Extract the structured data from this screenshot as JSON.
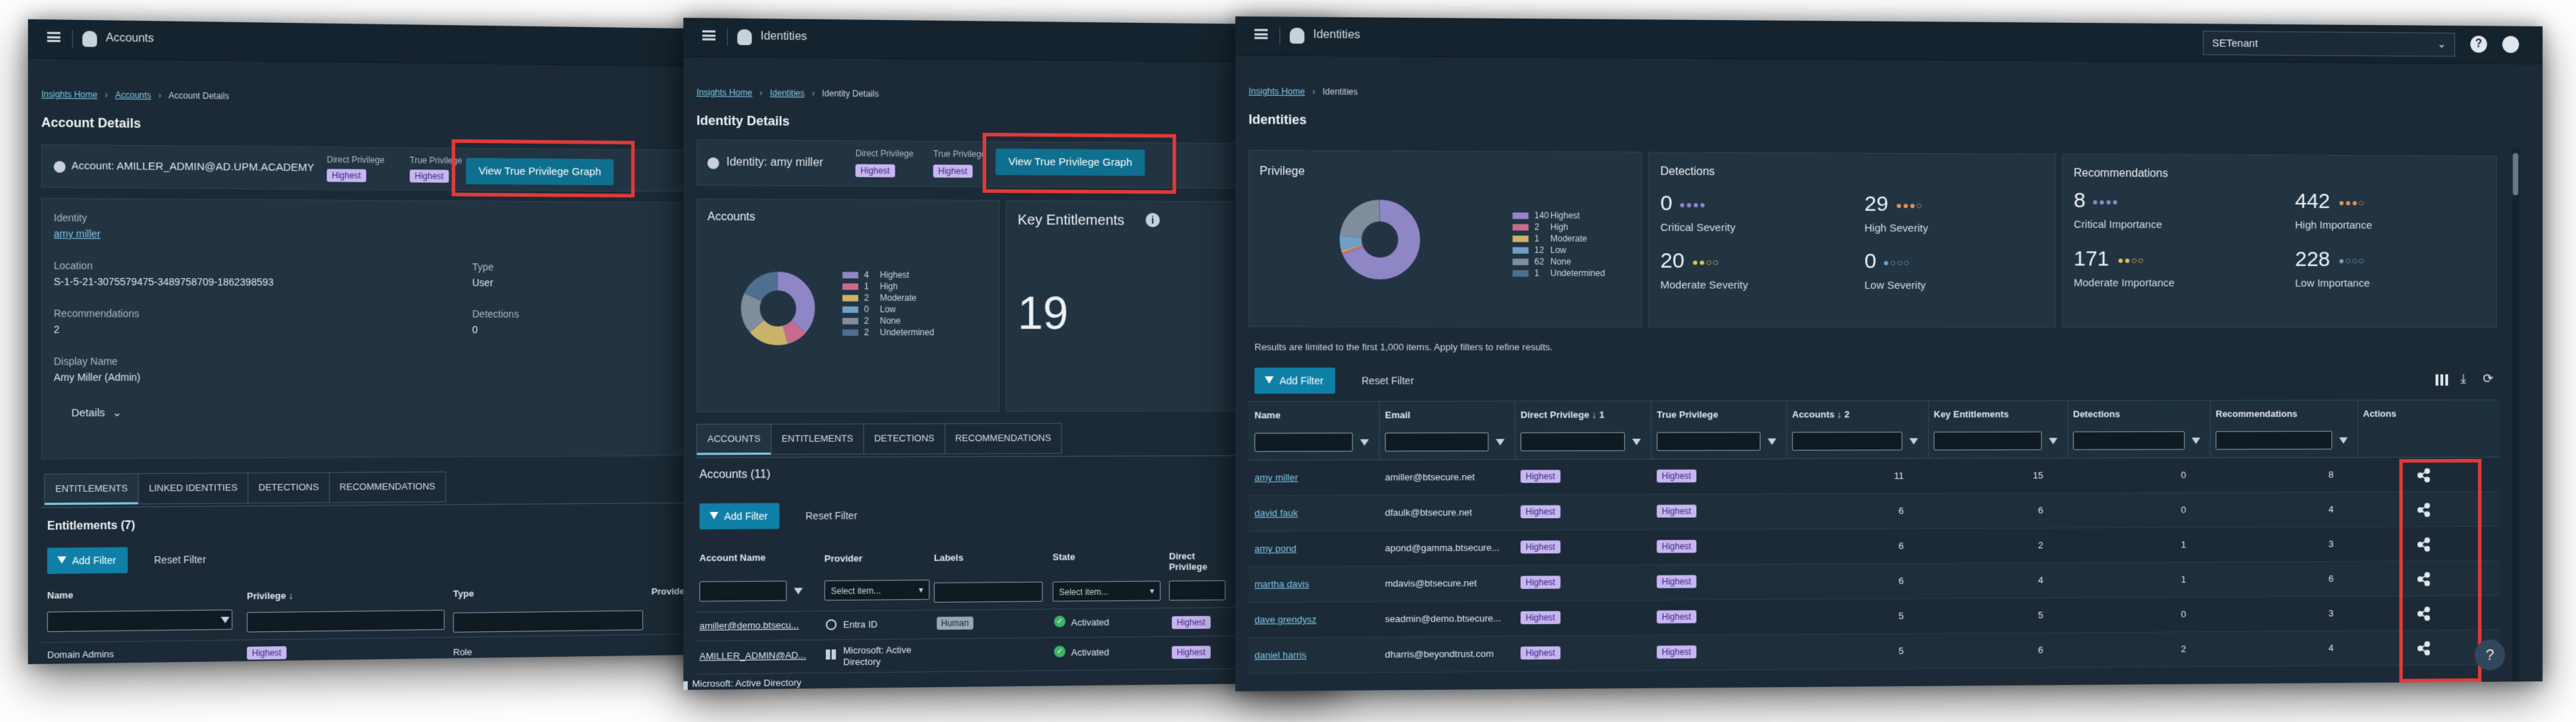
{
  "w1": {
    "topbar_title": "Accounts",
    "crumbs": [
      "Insights Home",
      "Accounts",
      "Account Details"
    ],
    "page_title": "Account Details",
    "account_label": "Account: AMILLER_ADMIN@AD.UPM.ACADEMY",
    "direct_priv_label": "Direct Privilege",
    "direct_priv_value": "Highest",
    "true_priv_label": "True Privilege",
    "true_priv_value": "Highest",
    "vtpg_button": "View True Privilege Graph",
    "identity_label": "Identity",
    "identity_value": "amy miller",
    "location_label": "Location",
    "location_value": "S-1-5-21-3075579475-3489758709-1862398593",
    "type_label": "Type",
    "type_value": "User",
    "recs_label": "Recommendations",
    "recs_value": "2",
    "detections_label": "Detections",
    "detections_value": "0",
    "display_name_label": "Display Name",
    "display_name_value": "Amy Miller (Admin)",
    "details_toggle": "Details",
    "tabs": [
      "ENTITLEMENTS",
      "LINKED IDENTITIES",
      "DETECTIONS",
      "RECOMMENDATIONS"
    ],
    "section_title": "Entitlements (7)",
    "add_filter": "Add Filter",
    "reset_filter": "Reset Filter",
    "columns": [
      "Name",
      "Privilege",
      "Type",
      "Provider"
    ],
    "row": {
      "name": "Domain Admins",
      "privilege": "Highest",
      "type": "Role"
    }
  },
  "w2": {
    "topbar_title": "Identities",
    "crumbs": [
      "Insights Home",
      "Identities",
      "Identity Details"
    ],
    "page_title": "Identity Details",
    "identity_label": "Identity: amy miller",
    "direct_priv_label": "Direct Privilege",
    "direct_priv_value": "Highest",
    "true_priv_label": "True Privilege",
    "true_priv_value": "Highest",
    "vtpg_button": "View True Privilege Graph",
    "accounts_title": "Accounts",
    "legend": [
      {
        "n": "4",
        "label": "Highest",
        "color": "#8f86c6"
      },
      {
        "n": "1",
        "label": "High",
        "color": "#c86b8e"
      },
      {
        "n": "2",
        "label": "Moderate",
        "color": "#c9b36a"
      },
      {
        "n": "0",
        "label": "Low",
        "color": "#6fa0c8"
      },
      {
        "n": "2",
        "label": "None",
        "color": "#7f8e9c"
      },
      {
        "n": "2",
        "label": "Undetermined",
        "color": "#4f6f90"
      }
    ],
    "key_ent_title": "Key Entitlements",
    "key_ent_value": "19",
    "tabs": [
      "ACCOUNTS",
      "ENTITLEMENTS",
      "DETECTIONS",
      "RECOMMENDATIONS"
    ],
    "section_title": "Accounts (11)",
    "add_filter": "Add Filter",
    "reset_filter": "Reset Filter",
    "columns": [
      "Account Name",
      "Provider",
      "Labels",
      "State",
      "Direct Privilege"
    ],
    "select_placeholder": "Select item...",
    "rows": [
      {
        "name": "amiller@demo.btsecu...",
        "provider": "Entra ID",
        "label": "Human",
        "state": "Activated",
        "priv": "Highest"
      },
      {
        "name": "AMILLER_ADMIN@AD...",
        "provider": "Microsoft: Active Directory",
        "label": "",
        "state": "Activated",
        "priv": "Highest"
      }
    ],
    "footer_provider": "Microsoft: Active Directory"
  },
  "w3": {
    "topbar_title": "Identities",
    "tenant": "SETenant",
    "crumbs": [
      "Insights Home",
      "Identities"
    ],
    "page_title": "Identities",
    "privilege_title": "Privilege",
    "legend": [
      {
        "n": "140",
        "label": "Highest",
        "color": "#8f86c6"
      },
      {
        "n": "2",
        "label": "High",
        "color": "#c86b8e"
      },
      {
        "n": "1",
        "label": "Moderate",
        "color": "#c9b36a"
      },
      {
        "n": "12",
        "label": "Low",
        "color": "#6fa0c8"
      },
      {
        "n": "62",
        "label": "None",
        "color": "#7f8e9c"
      },
      {
        "n": "1",
        "label": "Undetermined",
        "color": "#4f6f90"
      }
    ],
    "detections_title": "Detections",
    "detections": [
      {
        "n": "0",
        "label": "Critical Severity",
        "dots": "●●●●"
      },
      {
        "n": "29",
        "label": "High Severity",
        "dots": "●●●○"
      },
      {
        "n": "20",
        "label": "Moderate Severity",
        "dots": "●●○○"
      },
      {
        "n": "0",
        "label": "Low Severity",
        "dots": "●○○○"
      }
    ],
    "recs_title": "Recommendations",
    "recs": [
      {
        "n": "8",
        "label": "Critical Importance",
        "dots": "●●●●"
      },
      {
        "n": "442",
        "label": "High Importance",
        "dots": "●●●○"
      },
      {
        "n": "171",
        "label": "Moderate Importance",
        "dots": "●●○○"
      },
      {
        "n": "228",
        "label": "Low Importance",
        "dots": "●○○○"
      }
    ],
    "limit_note": "Results are limited to the first 1,000 items. Apply filters to refine results.",
    "add_filter": "Add Filter",
    "reset_filter": "Reset Filter",
    "columns": [
      "Name",
      "Email",
      "Direct Privilege ↓ 1",
      "True Privilege",
      "Accounts ↓ 2",
      "Key Entitlements",
      "Detections",
      "Recommendations",
      "Actions"
    ],
    "rows": [
      {
        "name": "amy miller",
        "email": "amiller@btsecure.net",
        "dp": "Highest",
        "tp": "Highest",
        "acc": "11",
        "ke": "15",
        "det": "0",
        "rec": "8"
      },
      {
        "name": "david fauk",
        "email": "dfaulk@btsecure.net",
        "dp": "Highest",
        "tp": "Highest",
        "acc": "6",
        "ke": "6",
        "det": "0",
        "rec": "4"
      },
      {
        "name": "amy pond",
        "email": "apond@gamma.btsecure...",
        "dp": "Highest",
        "tp": "Highest",
        "acc": "6",
        "ke": "2",
        "det": "1",
        "rec": "3"
      },
      {
        "name": "martha davis",
        "email": "mdavis@btsecure.net",
        "dp": "Highest",
        "tp": "Highest",
        "acc": "6",
        "ke": "4",
        "det": "1",
        "rec": "6"
      },
      {
        "name": "dave grendysz",
        "email": "seadmin@demo.btsecure...",
        "dp": "Highest",
        "tp": "Highest",
        "acc": "5",
        "ke": "5",
        "det": "0",
        "rec": "3"
      },
      {
        "name": "daniel harris",
        "email": "dharris@beyondtrust.com",
        "dp": "Highest",
        "tp": "Highest",
        "acc": "5",
        "ke": "6",
        "det": "2",
        "rec": "4"
      }
    ]
  }
}
